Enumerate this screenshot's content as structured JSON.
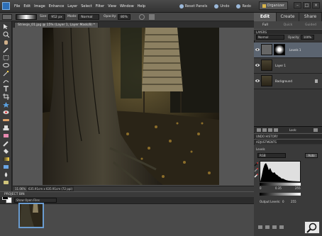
{
  "menu": {
    "items": [
      "File",
      "Edit",
      "Image",
      "Enhance",
      "Layer",
      "Select",
      "Filter",
      "View",
      "Window",
      "Help"
    ]
  },
  "top_actions": {
    "reset": "Reset Panels",
    "undo": "Undo",
    "redo": "Redo",
    "organizer": "Organizer"
  },
  "options_bar": {
    "size_label": "Size:",
    "size_value": "952 px",
    "mode_label": "Mode:",
    "mode_value": "Normal",
    "opacity_label": "Opacity:",
    "opacity_value": "80%"
  },
  "document": {
    "tab_title": "Striesje_01.jpg @ 15% (Layer 1, Layer Mask/8) *",
    "zoom": "11.06%",
    "doc_info": "635.91cm x 635.91cm (72 ppi)"
  },
  "project_bin": {
    "title": "PROJECT BIN",
    "select_value": "Show Open Files"
  },
  "right_panel": {
    "tabs": [
      "Edit",
      "Create",
      "Share"
    ],
    "subtabs": [
      "Full",
      "Quick",
      "Guided"
    ],
    "layers_title": "LAYERS",
    "blend_mode": "Normal",
    "opacity_label": "Opacity:",
    "opacity_value": "100%",
    "lock_label": "Lock:",
    "layers": [
      {
        "name": "Levels 1",
        "active": true
      },
      {
        "name": "Layer 1",
        "active": false
      },
      {
        "name": "Background",
        "active": false
      }
    ],
    "undo_history_title": "UNDO HISTORY",
    "adjustments_title": "ADJUSTMENTS",
    "levels_label": "Levels",
    "channel": "RGB",
    "auto_label": "Auto",
    "input_levels": [
      "0",
      "0.35",
      "255"
    ],
    "output_label": "Output Levels:",
    "output_levels": [
      "0",
      "255"
    ]
  },
  "colors": {
    "accent": "#5b6470",
    "panel_bg": "#333333",
    "canvas_bg": "#555555"
  }
}
